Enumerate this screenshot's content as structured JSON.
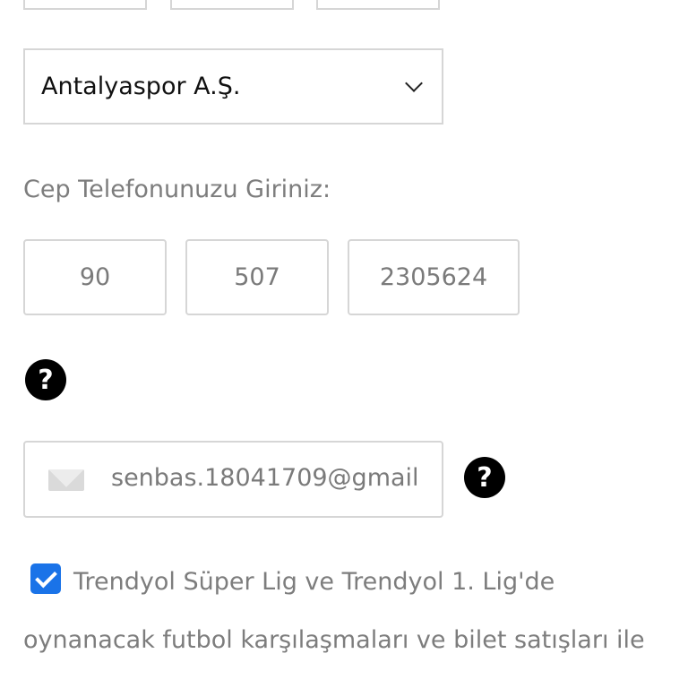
{
  "club_select": {
    "selected": "Antalyaspor A.Ş."
  },
  "phone": {
    "label": "Cep Telefonunuzu Giriniz:",
    "country_code": "90",
    "area_code": "507",
    "number": "2305624",
    "help_symbol": "?"
  },
  "email": {
    "icon": "envelope-icon",
    "value": "senbas.18041709@gmail",
    "help_symbol": "?"
  },
  "consent": {
    "checked": true,
    "line1": "Trendyol Süper Lig ve Trendyol 1. Lig'de",
    "line2": "oynanacak futbol karşılaşmaları ve bilet satışları ile"
  },
  "colors": {
    "checkbox": "#1a73e8",
    "border": "#d6d6d6",
    "muted_text": "#7d7d7d"
  }
}
